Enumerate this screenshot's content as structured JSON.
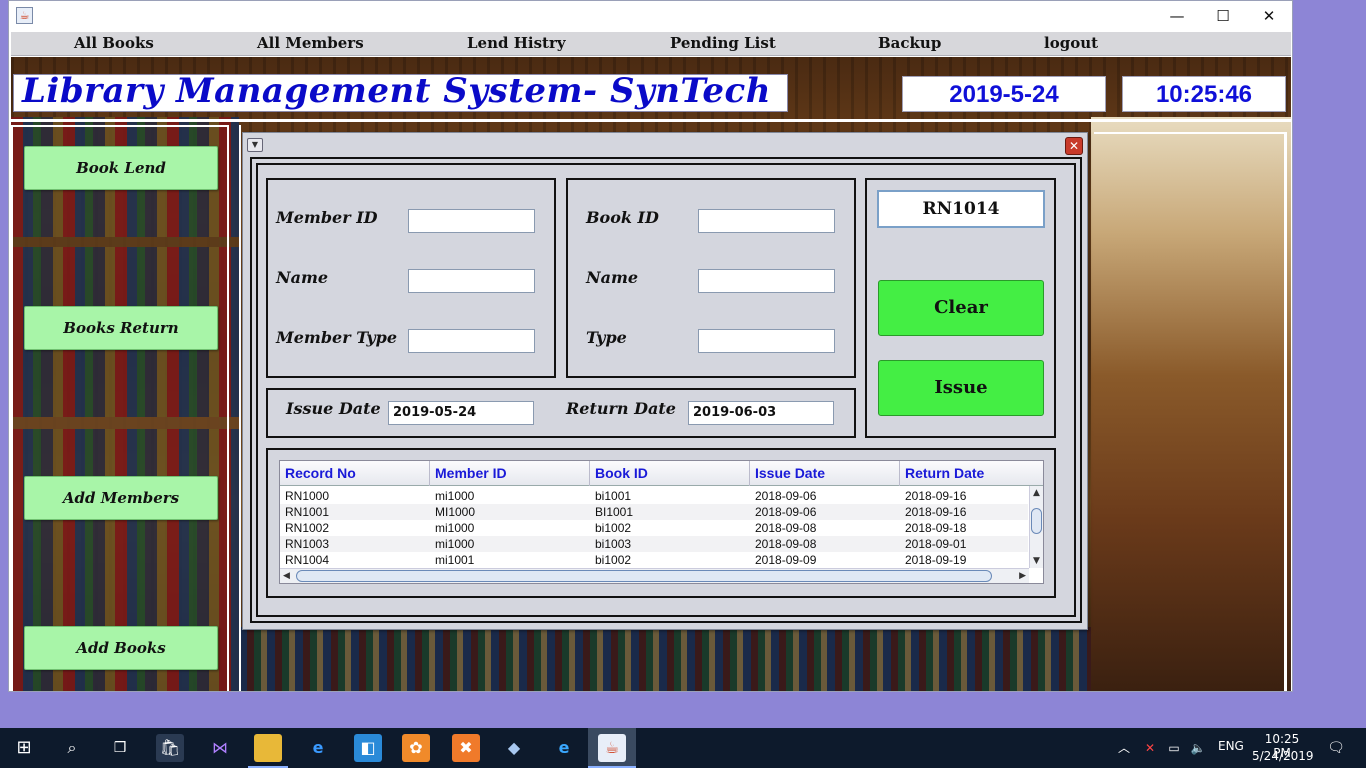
{
  "window": {
    "minimize_glyph": "—",
    "maximize_glyph": "☐",
    "close_glyph": "✕"
  },
  "menu": [
    "All Books",
    "All Members",
    "Lend Histry",
    "Pending List",
    "Backup",
    "logout"
  ],
  "header": {
    "title": "Library Management System- SynTech",
    "date": "2019-5-24",
    "time": "10:25:46"
  },
  "sidebar": [
    "Book Lend",
    "Books Return",
    "Add Members",
    "Add Books"
  ],
  "member_panel": {
    "id_label": "Member ID",
    "id_value": "",
    "name_label": "Name",
    "name_value": "",
    "type_label": "Member Type",
    "type_value": ""
  },
  "book_panel": {
    "id_label": "Book ID",
    "id_value": "",
    "name_label": "Name",
    "name_value": "",
    "type_label": "Type",
    "type_value": ""
  },
  "dates": {
    "issue_label": "Issue Date",
    "issue_value": "2019-05-24",
    "return_label": "Return Date",
    "return_value": "2019-06-03"
  },
  "actions": {
    "record_no": "RN1014",
    "clear_label": "Clear",
    "issue_label": "Issue"
  },
  "table": {
    "columns": [
      "Record No",
      "Member ID",
      "Book ID",
      "Issue Date",
      "Return Date"
    ],
    "rows": [
      [
        "RN1000",
        "mi1000",
        "bi1001",
        "2018-09-06",
        "2018-09-16"
      ],
      [
        "RN1001",
        "MI1000",
        "BI1001",
        "2018-09-06",
        "2018-09-16"
      ],
      [
        "RN1002",
        "mi1000",
        "bi1002",
        "2018-09-08",
        "2018-09-18"
      ],
      [
        "RN1003",
        "mi1000",
        "bi1003",
        "2018-09-08",
        "2018-09-01"
      ],
      [
        "RN1004",
        "mi1001",
        "bi1002",
        "2018-09-09",
        "2018-09-19"
      ]
    ]
  },
  "taskbar": {
    "language": "ENG",
    "clock_time": "10:25 PM",
    "clock_date": "5/24/2019"
  },
  "colors": {
    "title_blue": "#0a0ac8",
    "button_green": "#44ee44",
    "side_button_green": "#a8f5a8",
    "header_text_blue": "#1a1ad8"
  }
}
